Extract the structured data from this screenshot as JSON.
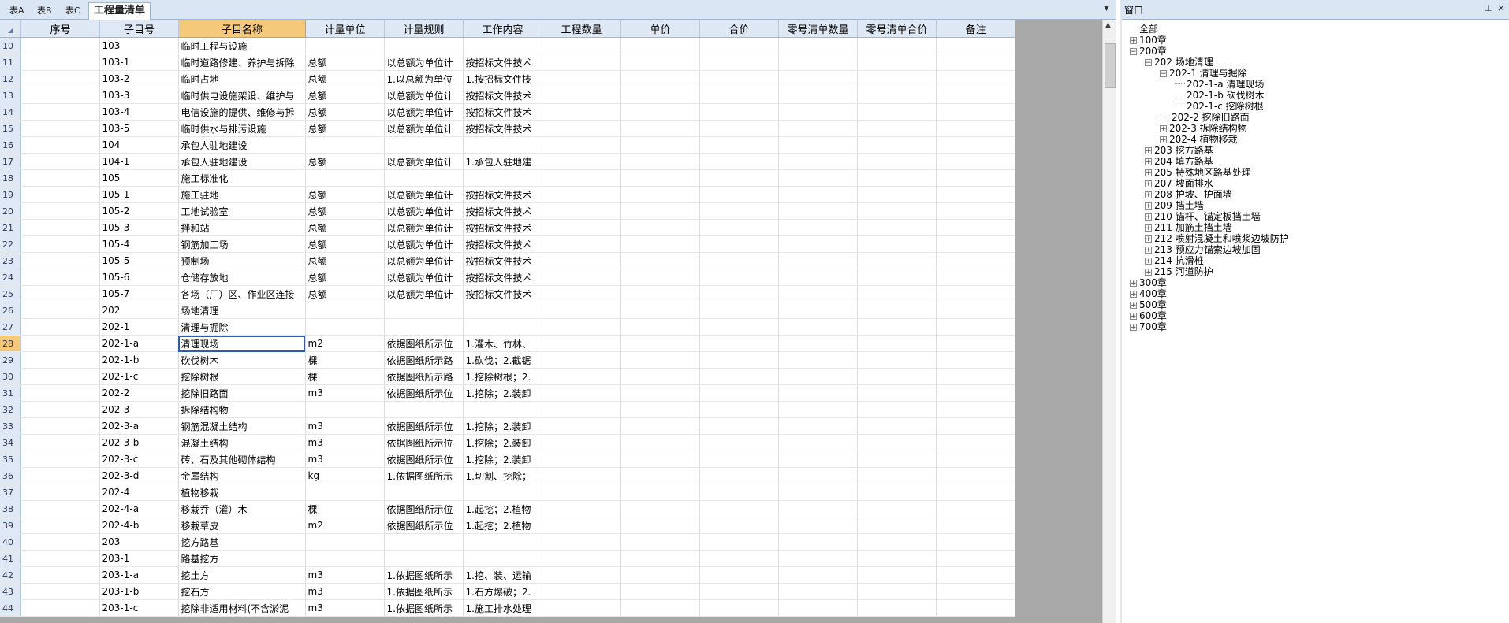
{
  "tabs": [
    {
      "label": "表A",
      "active": false
    },
    {
      "label": "表B",
      "active": false
    },
    {
      "label": "表C",
      "active": false
    },
    {
      "label": "工程量清单",
      "active": true
    }
  ],
  "columns": [
    "序号",
    "子目号",
    "子目名称",
    "计量单位",
    "计量规则",
    "工作内容",
    "工程数量",
    "单价",
    "合价",
    "零号清单数量",
    "零号清单合价",
    "备注"
  ],
  "selected_column": "子目名称",
  "rows": [
    {
      "rn": "10",
      "code": "103",
      "name": "临时工程与设施",
      "unit": "",
      "rule": "",
      "work": ""
    },
    {
      "rn": "11",
      "code": "103-1",
      "name": "临时道路修建、养护与拆除",
      "unit": "总额",
      "rule": "以总额为单位计",
      "work": "按招标文件技术"
    },
    {
      "rn": "12",
      "code": "103-2",
      "name": "临时占地",
      "unit": "总额",
      "rule": "1.以总额为单位",
      "work": "1.按招标文件技"
    },
    {
      "rn": "13",
      "code": "103-3",
      "name": "临时供电设施架设、维护与",
      "unit": "总额",
      "rule": "以总额为单位计",
      "work": "按招标文件技术"
    },
    {
      "rn": "14",
      "code": "103-4",
      "name": "电信设施的提供、维修与拆",
      "unit": "总额",
      "rule": "以总额为单位计",
      "work": "按招标文件技术"
    },
    {
      "rn": "15",
      "code": "103-5",
      "name": "临时供水与排污设施",
      "unit": "总额",
      "rule": "以总额为单位计",
      "work": "按招标文件技术"
    },
    {
      "rn": "16",
      "code": "104",
      "name": "承包人驻地建设",
      "unit": "",
      "rule": "",
      "work": ""
    },
    {
      "rn": "17",
      "code": "104-1",
      "name": "承包人驻地建设",
      "unit": "总额",
      "rule": "以总额为单位计",
      "work": "1.承包人驻地建"
    },
    {
      "rn": "18",
      "code": "105",
      "name": "施工标准化",
      "unit": "",
      "rule": "",
      "work": ""
    },
    {
      "rn": "19",
      "code": "105-1",
      "name": "施工驻地",
      "unit": "总额",
      "rule": "以总额为单位计",
      "work": "按招标文件技术"
    },
    {
      "rn": "20",
      "code": "105-2",
      "name": "工地试验室",
      "unit": "总额",
      "rule": "以总额为单位计",
      "work": "按招标文件技术"
    },
    {
      "rn": "21",
      "code": "105-3",
      "name": "拌和站",
      "unit": "总额",
      "rule": "以总额为单位计",
      "work": "按招标文件技术"
    },
    {
      "rn": "22",
      "code": "105-4",
      "name": "钢筋加工场",
      "unit": "总额",
      "rule": "以总额为单位计",
      "work": "按招标文件技术"
    },
    {
      "rn": "23",
      "code": "105-5",
      "name": "预制场",
      "unit": "总额",
      "rule": "以总额为单位计",
      "work": "按招标文件技术"
    },
    {
      "rn": "24",
      "code": "105-6",
      "name": "仓储存放地",
      "unit": "总额",
      "rule": "以总额为单位计",
      "work": "按招标文件技术"
    },
    {
      "rn": "25",
      "code": "105-7",
      "name": "各场（厂）区、作业区连接",
      "unit": "总额",
      "rule": "以总额为单位计",
      "work": "按招标文件技术"
    },
    {
      "rn": "26",
      "code": "202",
      "name": "场地清理",
      "unit": "",
      "rule": "",
      "work": ""
    },
    {
      "rn": "27",
      "code": "202-1",
      "name": "清理与掘除",
      "unit": "",
      "rule": "",
      "work": ""
    },
    {
      "rn": "28",
      "code": "202-1-a",
      "name": "清理现场",
      "unit": "m2",
      "rule": "依据图纸所示位",
      "work": "1.灌木、竹林、"
    },
    {
      "rn": "29",
      "code": "202-1-b",
      "name": "砍伐树木",
      "unit": "棵",
      "rule": "依据图纸所示路",
      "work": "1.砍伐；2.截锯"
    },
    {
      "rn": "30",
      "code": "202-1-c",
      "name": "挖除树根",
      "unit": "棵",
      "rule": "依据图纸所示路",
      "work": "1.挖除树根；2."
    },
    {
      "rn": "31",
      "code": "202-2",
      "name": "挖除旧路面",
      "unit": "m3",
      "rule": "依据图纸所示位",
      "work": "1.挖除；2.装卸"
    },
    {
      "rn": "32",
      "code": "202-3",
      "name": "拆除结构物",
      "unit": "",
      "rule": "",
      "work": ""
    },
    {
      "rn": "33",
      "code": "202-3-a",
      "name": "钢筋混凝土结构",
      "unit": "m3",
      "rule": "依据图纸所示位",
      "work": "1.挖除；2.装卸"
    },
    {
      "rn": "34",
      "code": "202-3-b",
      "name": "混凝土结构",
      "unit": "m3",
      "rule": "依据图纸所示位",
      "work": "1.挖除；2.装卸"
    },
    {
      "rn": "35",
      "code": "202-3-c",
      "name": "砖、石及其他砌体结构",
      "unit": "m3",
      "rule": "依据图纸所示位",
      "work": "1.挖除；2.装卸"
    },
    {
      "rn": "36",
      "code": "202-3-d",
      "name": "金属结构",
      "unit": "kg",
      "rule": "1.依据图纸所示",
      "work": "1.切割、挖除；"
    },
    {
      "rn": "37",
      "code": "202-4",
      "name": "植物移栽",
      "unit": "",
      "rule": "",
      "work": ""
    },
    {
      "rn": "38",
      "code": "202-4-a",
      "name": "移栽乔（灌）木",
      "unit": "棵",
      "rule": "依据图纸所示位",
      "work": "1.起挖；2.植物"
    },
    {
      "rn": "39",
      "code": "202-4-b",
      "name": "移栽草皮",
      "unit": "m2",
      "rule": "依据图纸所示位",
      "work": "1.起挖；2.植物"
    },
    {
      "rn": "40",
      "code": "203",
      "name": "挖方路基",
      "unit": "",
      "rule": "",
      "work": ""
    },
    {
      "rn": "41",
      "code": "203-1",
      "name": "路基挖方",
      "unit": "",
      "rule": "",
      "work": ""
    },
    {
      "rn": "42",
      "code": "203-1-a",
      "name": "挖土方",
      "unit": "m3",
      "rule": "1.依据图纸所示",
      "work": "1.挖、装、运输"
    },
    {
      "rn": "43",
      "code": "203-1-b",
      "name": "挖石方",
      "unit": "m3",
      "rule": "1.依据图纸所示",
      "work": "1.石方爆破；2."
    },
    {
      "rn": "44",
      "code": "203-1-c",
      "name": "挖除非适用材料(不含淤泥",
      "unit": "m3",
      "rule": "1.依据图纸所示",
      "work": "1.施工排水处理"
    }
  ],
  "selected_row": "28",
  "panel": {
    "title": "窗口",
    "pin_glyph": "⊥",
    "close_glyph": "×",
    "tree": [
      {
        "label": "全部",
        "depth": 0,
        "exp": ""
      },
      {
        "label": "100章",
        "depth": 1,
        "exp": "+"
      },
      {
        "label": "200章",
        "depth": 1,
        "exp": "-"
      },
      {
        "label": "202 场地清理",
        "depth": 2,
        "exp": "-"
      },
      {
        "label": "202-1 清理与掘除",
        "depth": 3,
        "exp": "-"
      },
      {
        "label": "202-1-a 清理现场",
        "depth": 4,
        "exp": ""
      },
      {
        "label": "202-1-b 砍伐树木",
        "depth": 4,
        "exp": ""
      },
      {
        "label": "202-1-c 挖除树根",
        "depth": 4,
        "exp": ""
      },
      {
        "label": "202-2 挖除旧路面",
        "depth": 3,
        "exp": ""
      },
      {
        "label": "202-3 拆除结构物",
        "depth": 3,
        "exp": "+"
      },
      {
        "label": "202-4 植物移栽",
        "depth": 3,
        "exp": "+"
      },
      {
        "label": "203 挖方路基",
        "depth": 2,
        "exp": "+"
      },
      {
        "label": "204 填方路基",
        "depth": 2,
        "exp": "+"
      },
      {
        "label": "205 特殊地区路基处理",
        "depth": 2,
        "exp": "+"
      },
      {
        "label": "207 坡面排水",
        "depth": 2,
        "exp": "+"
      },
      {
        "label": "208 护坡、护面墙",
        "depth": 2,
        "exp": "+"
      },
      {
        "label": "209 挡土墙",
        "depth": 2,
        "exp": "+"
      },
      {
        "label": "210 锚杆、锚定板挡土墙",
        "depth": 2,
        "exp": "+"
      },
      {
        "label": "211 加筋土挡土墙",
        "depth": 2,
        "exp": "+"
      },
      {
        "label": "212 喷射混凝土和喷浆边坡防护",
        "depth": 2,
        "exp": "+"
      },
      {
        "label": "213 预应力锚索边坡加固",
        "depth": 2,
        "exp": "+"
      },
      {
        "label": "214 抗滑桩",
        "depth": 2,
        "exp": "+"
      },
      {
        "label": "215 河道防护",
        "depth": 2,
        "exp": "+"
      },
      {
        "label": "300章",
        "depth": 1,
        "exp": "+"
      },
      {
        "label": "400章",
        "depth": 1,
        "exp": "+"
      },
      {
        "label": "500章",
        "depth": 1,
        "exp": "+"
      },
      {
        "label": "600章",
        "depth": 1,
        "exp": "+"
      },
      {
        "label": "700章",
        "depth": 1,
        "exp": "+"
      }
    ]
  },
  "icons": {
    "dropdown": "▼",
    "scroll_up": "▲"
  },
  "colors": {
    "header_bg": "#dfe8f5",
    "selected_header": "#f5c97a",
    "tabbar_bg": "#dbe6f4",
    "empty_area": "#a8a8a8"
  }
}
